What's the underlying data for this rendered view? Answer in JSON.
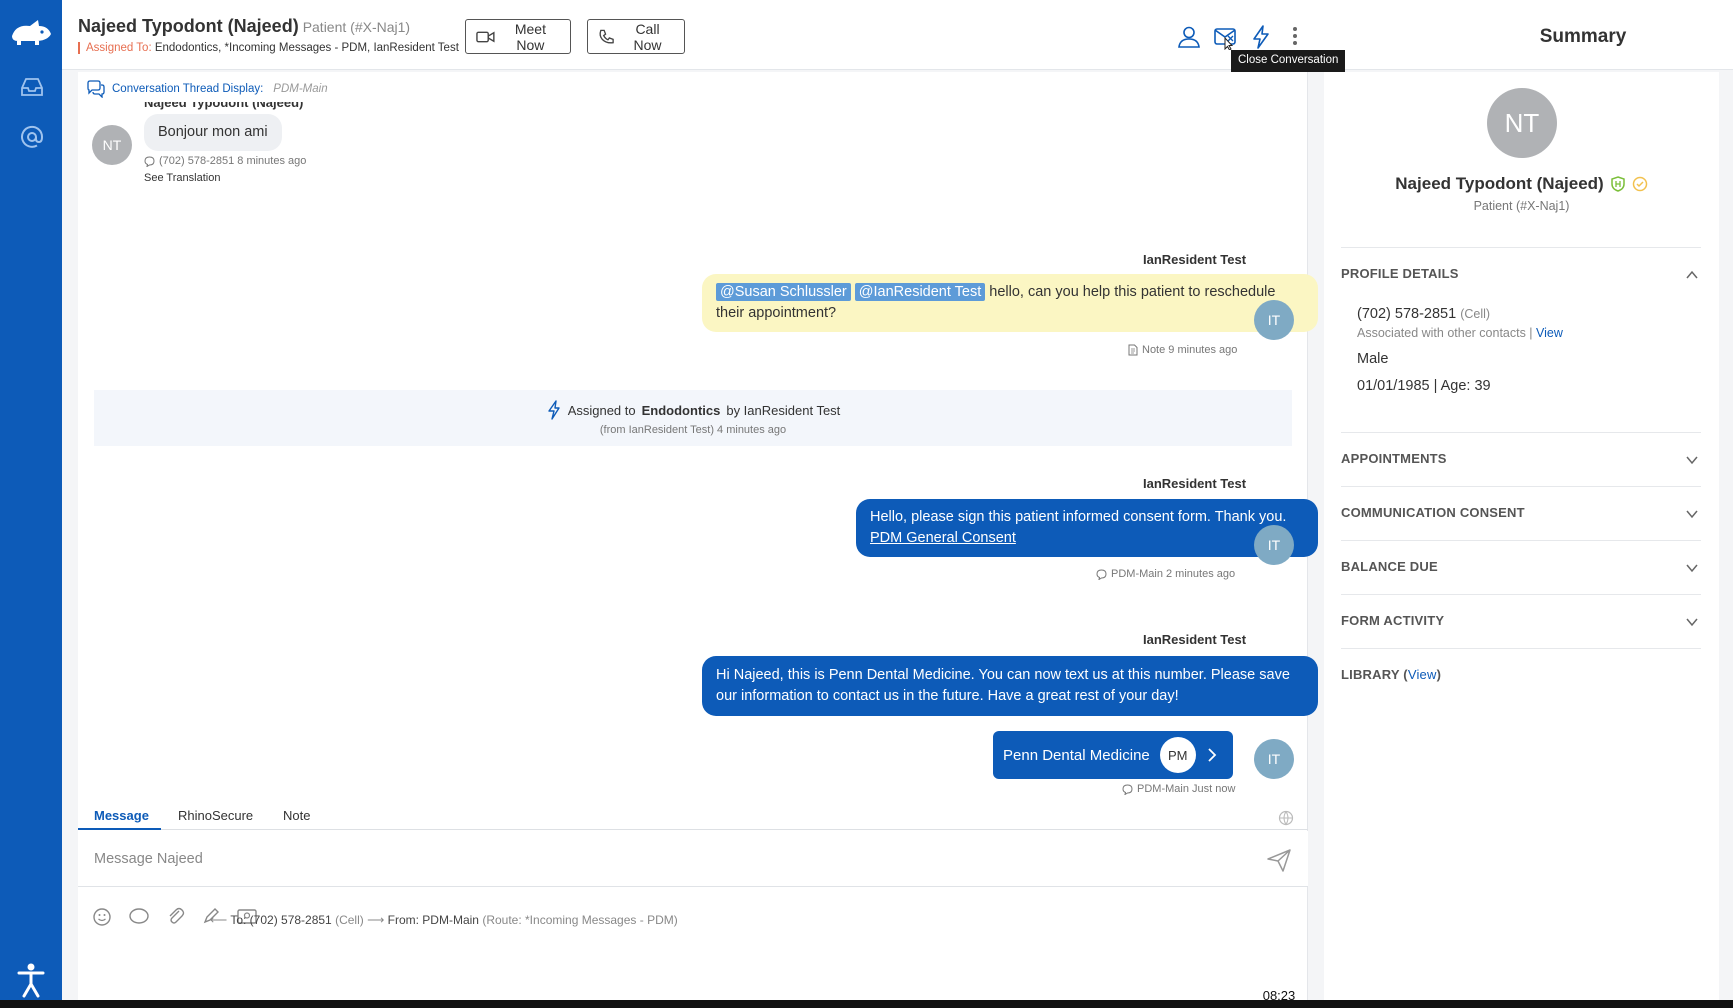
{
  "header": {
    "patient_name": "Najeed Typodont (Najeed)",
    "patient_id": "Patient (#X-Naj1)",
    "assigned_label": "Assigned To:",
    "assigned_value": "Endodontics, *Incoming Messages - PDM, IanResident Test",
    "meet_now": "Meet Now",
    "call_now": "Call Now",
    "tooltip": "Close Conversation",
    "summary_title": "Summary"
  },
  "thread": {
    "display_label": "Conversation Thread Display:",
    "display_channel": "PDM-Main",
    "partial_sender": "Najeed Typodont (Najeed)",
    "inbound": {
      "avatar": "NT",
      "text": "Bonjour mon ami",
      "meta": "(702) 578-2851  8 minutes ago",
      "see_translation": "See Translation"
    },
    "note": {
      "sender": "IanResident Test",
      "mention1": "@Susan Schlussler",
      "mention2": "@IanResident Test",
      "text": "hello, can you help this patient to reschedule their appointment?",
      "meta": "Note  9 minutes ago",
      "avatar": "IT"
    },
    "event": {
      "prefix": "Assigned to",
      "target": "Endodontics",
      "suffix": "by IanResident Test",
      "meta": "(from IanResident Test)  4 minutes ago"
    },
    "outbound1": {
      "sender": "IanResident Test",
      "text": "Hello, please sign this patient informed consent form. Thank you.",
      "link": "PDM General Consent",
      "meta": "PDM-Main  2 minutes ago",
      "avatar": "IT"
    },
    "outbound2": {
      "sender": "IanResident Test",
      "text": "Hi Najeed, this is Penn Dental Medicine. You can now text us at this number. Please save our information to contact us in the future. Have a great rest of your day!",
      "card_label": "Penn Dental Medicine",
      "card_initials": "PM",
      "meta": "PDM-Main  Just now",
      "avatar": "IT"
    }
  },
  "composer": {
    "tabs": [
      "Message",
      "RhinoSecure",
      "Note"
    ],
    "placeholder": "Message Najeed",
    "to": "To: (702) 578-2851",
    "to_type": "(Cell)",
    "from": "From: PDM-Main",
    "route": "(Route: *Incoming Messages - PDM)"
  },
  "summary": {
    "avatar": "NT",
    "name": "Najeed Typodont (Najeed)",
    "patient_id": "Patient (#X-Naj1)",
    "profile_title": "PROFILE DETAILS",
    "phone": "(702) 578-2851",
    "phone_type": "(Cell)",
    "associated": "Associated with other contacts |",
    "view": "View",
    "gender": "Male",
    "dob": "01/01/1985 | Age: 39",
    "appointments": "APPOINTMENTS",
    "consent": "COMMUNICATION CONSENT",
    "balance": "BALANCE DUE",
    "forms": "FORM ACTIVITY",
    "library": "LIBRARY (",
    "library_view": "View",
    "library_close": ")"
  },
  "player": {
    "time": "08:23"
  },
  "colors": {
    "brand": "#0d5bb8",
    "note": "#fbf6c3",
    "mention": "#5d9bd8",
    "assigned": "#e76f51"
  }
}
